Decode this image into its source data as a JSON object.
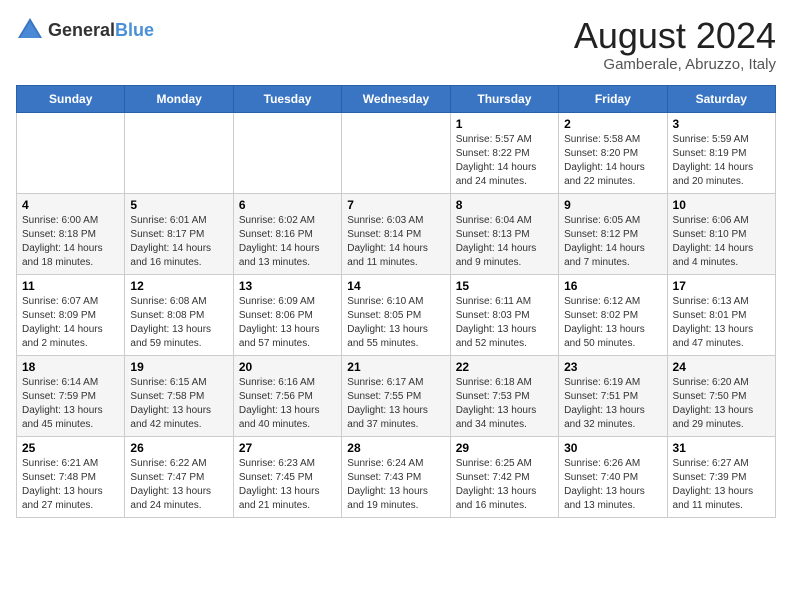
{
  "header": {
    "logo_general": "General",
    "logo_blue": "Blue",
    "month_year": "August 2024",
    "location": "Gamberale, Abruzzo, Italy"
  },
  "weekdays": [
    "Sunday",
    "Monday",
    "Tuesday",
    "Wednesday",
    "Thursday",
    "Friday",
    "Saturday"
  ],
  "weeks": [
    [
      {
        "day": "",
        "info": ""
      },
      {
        "day": "",
        "info": ""
      },
      {
        "day": "",
        "info": ""
      },
      {
        "day": "",
        "info": ""
      },
      {
        "day": "1",
        "info": "Sunrise: 5:57 AM\nSunset: 8:22 PM\nDaylight: 14 hours\nand 24 minutes."
      },
      {
        "day": "2",
        "info": "Sunrise: 5:58 AM\nSunset: 8:20 PM\nDaylight: 14 hours\nand 22 minutes."
      },
      {
        "day": "3",
        "info": "Sunrise: 5:59 AM\nSunset: 8:19 PM\nDaylight: 14 hours\nand 20 minutes."
      }
    ],
    [
      {
        "day": "4",
        "info": "Sunrise: 6:00 AM\nSunset: 8:18 PM\nDaylight: 14 hours\nand 18 minutes."
      },
      {
        "day": "5",
        "info": "Sunrise: 6:01 AM\nSunset: 8:17 PM\nDaylight: 14 hours\nand 16 minutes."
      },
      {
        "day": "6",
        "info": "Sunrise: 6:02 AM\nSunset: 8:16 PM\nDaylight: 14 hours\nand 13 minutes."
      },
      {
        "day": "7",
        "info": "Sunrise: 6:03 AM\nSunset: 8:14 PM\nDaylight: 14 hours\nand 11 minutes."
      },
      {
        "day": "8",
        "info": "Sunrise: 6:04 AM\nSunset: 8:13 PM\nDaylight: 14 hours\nand 9 minutes."
      },
      {
        "day": "9",
        "info": "Sunrise: 6:05 AM\nSunset: 8:12 PM\nDaylight: 14 hours\nand 7 minutes."
      },
      {
        "day": "10",
        "info": "Sunrise: 6:06 AM\nSunset: 8:10 PM\nDaylight: 14 hours\nand 4 minutes."
      }
    ],
    [
      {
        "day": "11",
        "info": "Sunrise: 6:07 AM\nSunset: 8:09 PM\nDaylight: 14 hours\nand 2 minutes."
      },
      {
        "day": "12",
        "info": "Sunrise: 6:08 AM\nSunset: 8:08 PM\nDaylight: 13 hours\nand 59 minutes."
      },
      {
        "day": "13",
        "info": "Sunrise: 6:09 AM\nSunset: 8:06 PM\nDaylight: 13 hours\nand 57 minutes."
      },
      {
        "day": "14",
        "info": "Sunrise: 6:10 AM\nSunset: 8:05 PM\nDaylight: 13 hours\nand 55 minutes."
      },
      {
        "day": "15",
        "info": "Sunrise: 6:11 AM\nSunset: 8:03 PM\nDaylight: 13 hours\nand 52 minutes."
      },
      {
        "day": "16",
        "info": "Sunrise: 6:12 AM\nSunset: 8:02 PM\nDaylight: 13 hours\nand 50 minutes."
      },
      {
        "day": "17",
        "info": "Sunrise: 6:13 AM\nSunset: 8:01 PM\nDaylight: 13 hours\nand 47 minutes."
      }
    ],
    [
      {
        "day": "18",
        "info": "Sunrise: 6:14 AM\nSunset: 7:59 PM\nDaylight: 13 hours\nand 45 minutes."
      },
      {
        "day": "19",
        "info": "Sunrise: 6:15 AM\nSunset: 7:58 PM\nDaylight: 13 hours\nand 42 minutes."
      },
      {
        "day": "20",
        "info": "Sunrise: 6:16 AM\nSunset: 7:56 PM\nDaylight: 13 hours\nand 40 minutes."
      },
      {
        "day": "21",
        "info": "Sunrise: 6:17 AM\nSunset: 7:55 PM\nDaylight: 13 hours\nand 37 minutes."
      },
      {
        "day": "22",
        "info": "Sunrise: 6:18 AM\nSunset: 7:53 PM\nDaylight: 13 hours\nand 34 minutes."
      },
      {
        "day": "23",
        "info": "Sunrise: 6:19 AM\nSunset: 7:51 PM\nDaylight: 13 hours\nand 32 minutes."
      },
      {
        "day": "24",
        "info": "Sunrise: 6:20 AM\nSunset: 7:50 PM\nDaylight: 13 hours\nand 29 minutes."
      }
    ],
    [
      {
        "day": "25",
        "info": "Sunrise: 6:21 AM\nSunset: 7:48 PM\nDaylight: 13 hours\nand 27 minutes."
      },
      {
        "day": "26",
        "info": "Sunrise: 6:22 AM\nSunset: 7:47 PM\nDaylight: 13 hours\nand 24 minutes."
      },
      {
        "day": "27",
        "info": "Sunrise: 6:23 AM\nSunset: 7:45 PM\nDaylight: 13 hours\nand 21 minutes."
      },
      {
        "day": "28",
        "info": "Sunrise: 6:24 AM\nSunset: 7:43 PM\nDaylight: 13 hours\nand 19 minutes."
      },
      {
        "day": "29",
        "info": "Sunrise: 6:25 AM\nSunset: 7:42 PM\nDaylight: 13 hours\nand 16 minutes."
      },
      {
        "day": "30",
        "info": "Sunrise: 6:26 AM\nSunset: 7:40 PM\nDaylight: 13 hours\nand 13 minutes."
      },
      {
        "day": "31",
        "info": "Sunrise: 6:27 AM\nSunset: 7:39 PM\nDaylight: 13 hours\nand 11 minutes."
      }
    ]
  ]
}
